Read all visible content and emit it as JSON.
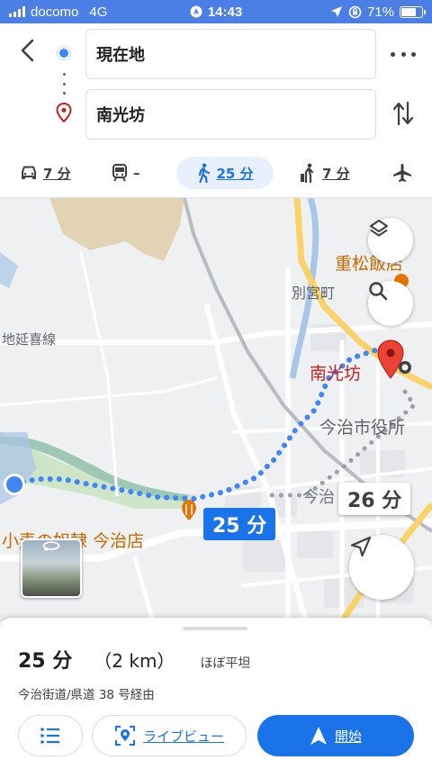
{
  "status_bar": {
    "carrier": "docomo",
    "network": "4G",
    "time": "14:43",
    "battery": "71%"
  },
  "route": {
    "origin": "現在地",
    "destination": "南光坊"
  },
  "modes": [
    {
      "name": "car",
      "label": "7 分"
    },
    {
      "name": "transit",
      "label": "–"
    },
    {
      "name": "walk",
      "label": "25 分"
    },
    {
      "name": "ride",
      "label": "7 分"
    },
    {
      "name": "flight",
      "label": ""
    }
  ],
  "map": {
    "labels": {
      "place_shigematsu": "重松飯店",
      "area_beguchi": "別宮町",
      "road_enki": "地延喜線",
      "dest_name": "南光坊",
      "city_hall": "今治市役所",
      "area_imabari_partial": "今治",
      "store_name": "小麦の奴隷 今治店"
    },
    "route_time_badge": "25 分",
    "alt_route_badge": "26 分"
  },
  "sheet": {
    "duration": "25 分",
    "distance": "（2 km）",
    "terrain": "ほぼ平坦",
    "via": "今治街道/県道 38 号経由",
    "live_view_label": "ライブビュー",
    "start_label": "開始"
  },
  "colors": {
    "accent": "#1a73e8",
    "route_dots": "#4285f4",
    "status_bar": "#4b7fe6",
    "dest_pin": "#ea4335",
    "label_orange": "#e37400"
  }
}
